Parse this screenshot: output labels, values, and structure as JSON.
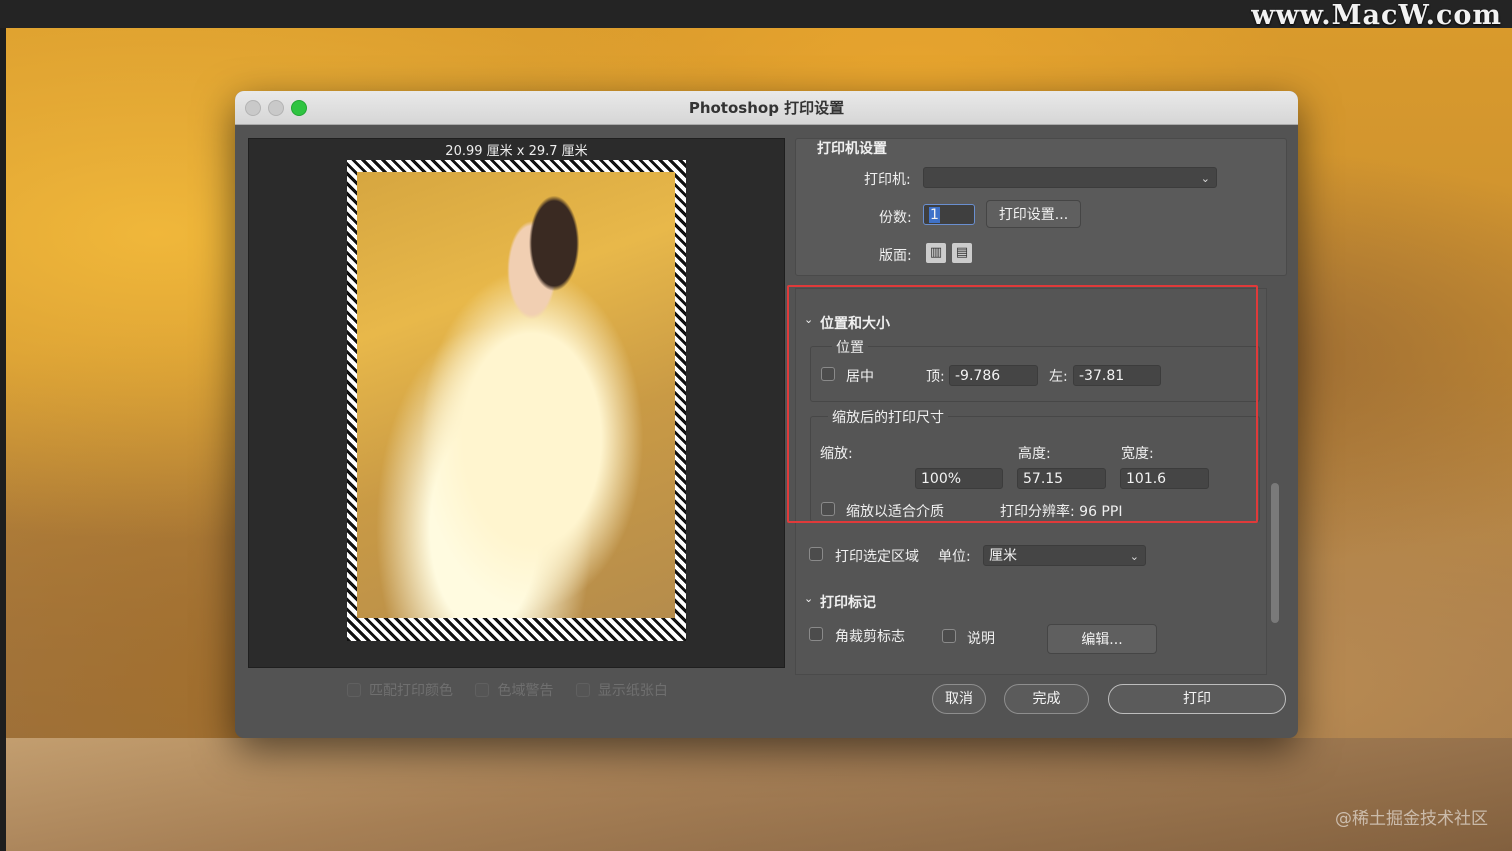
{
  "watermark_top": "www.MacW.com",
  "watermark_bottom": "@稀土掘金技术社区",
  "dialog": {
    "title": "Photoshop 打印设置",
    "preview": {
      "dimensions": "20.99 厘米 x 29.7 厘米"
    },
    "bottom_checks": [
      "匹配打印颜色",
      "色域警告",
      "显示纸张白"
    ],
    "printer_settings": {
      "heading": "打印机设置",
      "printer_label": "打印机:",
      "printer_value": "",
      "copies_label": "份数:",
      "copies_value": "1",
      "print_settings_button": "打印设置...",
      "layout_label": "版面:",
      "layout_icons": [
        "portrait-icon",
        "landscape-icon"
      ]
    },
    "position_size": {
      "heading": "位置和大小",
      "position_group": "位置",
      "center_label": "居中",
      "top_label": "顶:",
      "top_value": "-9.786",
      "left_label": "左:",
      "left_value": "-37.81",
      "scaled_group": "缩放后的打印尺寸",
      "scale_label": "缩放:",
      "height_label": "高度:",
      "width_label": "宽度:",
      "scale_value": "100%",
      "height_value": "57.15",
      "width_value": "101.6",
      "fit_media_label": "缩放以适合介质",
      "resolution": "打印分辨率: 96 PPI"
    },
    "print_selection": {
      "label": "打印选定区域",
      "unit_label": "单位:",
      "unit_value": "厘米"
    },
    "print_marks": {
      "heading": "打印标记",
      "crop_marks": "角裁剪标志",
      "description": "说明",
      "edit_button": "编辑..."
    },
    "footer": {
      "cancel": "取消",
      "done": "完成",
      "print": "打印"
    }
  }
}
